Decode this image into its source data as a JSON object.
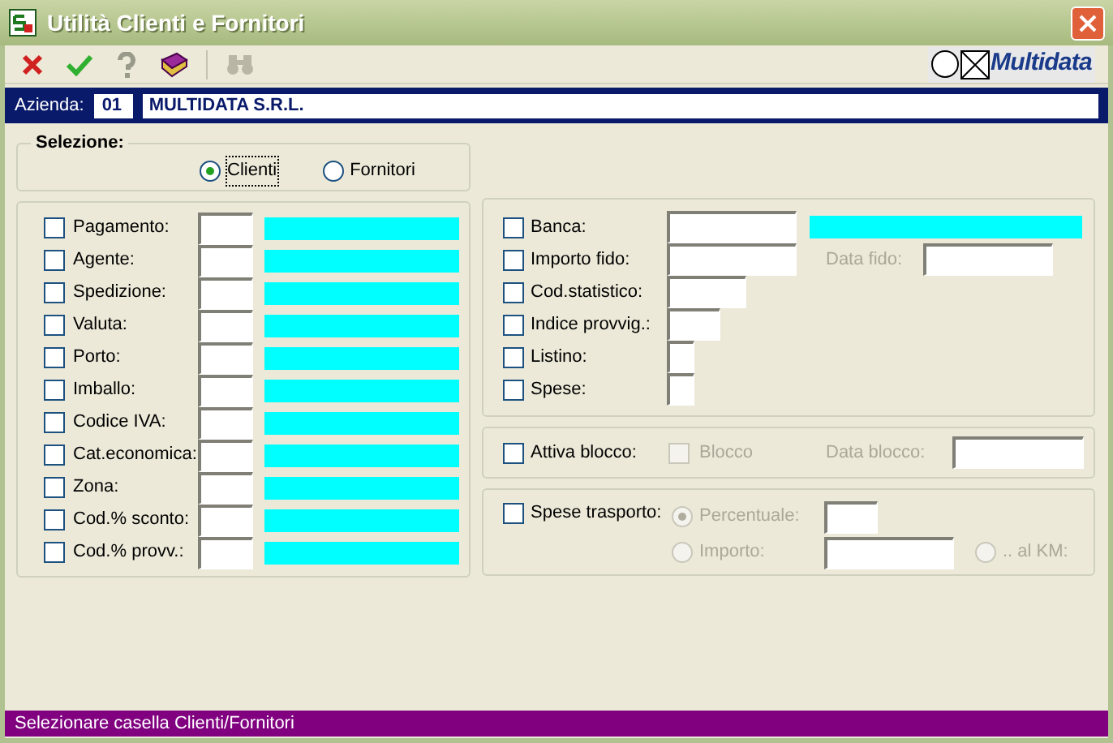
{
  "window": {
    "title": "Utilità Clienti e Fornitori"
  },
  "toolbar": [
    {
      "kind": "cancel",
      "disabled": false
    },
    {
      "kind": "confirm",
      "disabled": false
    },
    {
      "kind": "help",
      "disabled": false
    },
    {
      "kind": "book",
      "disabled": false
    },
    {
      "kind": "find",
      "disabled": true
    }
  ],
  "logo": {
    "text": "Multidata"
  },
  "company": {
    "label": "Azienda:",
    "code": "01",
    "name": "MULTIDATA S.R.L."
  },
  "selection": {
    "title": "Selezione:",
    "options": [
      {
        "label": "Clienti",
        "selected": true
      },
      {
        "label": "Fornitori",
        "selected": false
      }
    ]
  },
  "left_filters": [
    {
      "label": "Pagamento:",
      "checked": false
    },
    {
      "label": "Agente:",
      "checked": false
    },
    {
      "label": "Spedizione:",
      "checked": false
    },
    {
      "label": "Valuta:",
      "checked": false
    },
    {
      "label": "Porto:",
      "checked": false
    },
    {
      "label": "Imballo:",
      "checked": false
    },
    {
      "label": "Codice IVA:",
      "checked": false
    },
    {
      "label": "Cat.economica:",
      "checked": false
    },
    {
      "label": "Zona:",
      "checked": false
    },
    {
      "label": "Cod.% sconto:",
      "checked": false
    },
    {
      "label": "Cod.% provv.:",
      "checked": false
    }
  ],
  "right_filters": [
    {
      "label": "Banca:",
      "checked": false,
      "kind": "described"
    },
    {
      "label": "Importo fido:",
      "checked": false,
      "kind": "dated",
      "date_label": "Data fido:"
    },
    {
      "label": "Cod.statistico:",
      "checked": false,
      "kind": "medium"
    },
    {
      "label": "Indice provvig.:",
      "checked": false,
      "kind": "short"
    },
    {
      "label": "Listino:",
      "checked": false,
      "kind": "tiny"
    },
    {
      "label": "Spese:",
      "checked": false,
      "kind": "tiny"
    }
  ],
  "block": {
    "label": "Attiva blocco:",
    "checked": false,
    "block_label": "Blocco",
    "block_checked": false,
    "block_disabled": true,
    "date_label": "Data blocco:"
  },
  "transport": {
    "label": "Spese trasporto:",
    "checked": false,
    "disabled": true,
    "options": [
      {
        "label": "Percentuale:",
        "selected": true
      },
      {
        "label": "Importo:",
        "selected": false
      },
      {
        "label": ".. al KM:",
        "selected": false
      }
    ]
  },
  "status_bar": "Selezionare casella Clienti/Fornitori"
}
